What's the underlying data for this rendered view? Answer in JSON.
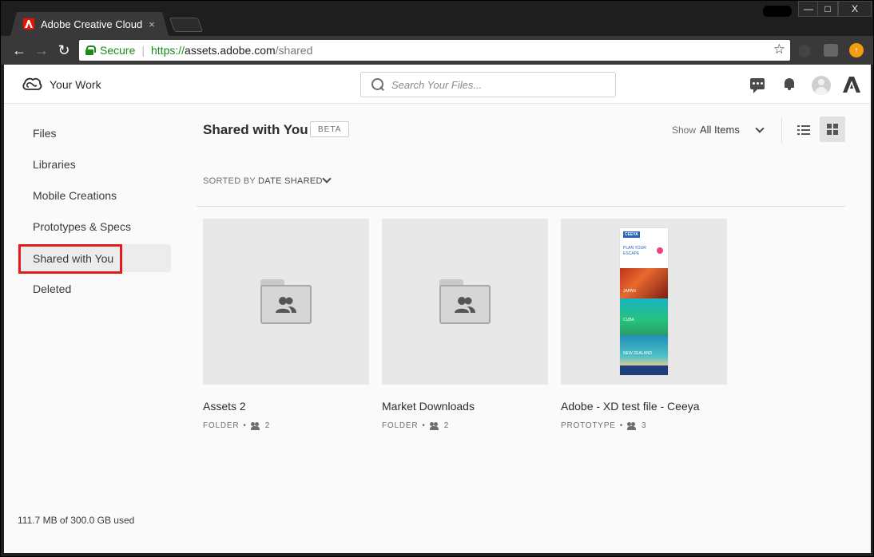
{
  "browser": {
    "tab_title": "Adobe Creative Cloud",
    "tab_close": "×",
    "win_min": "—",
    "win_max": "□",
    "win_close": "X",
    "nav_back": "←",
    "nav_forward": "→",
    "nav_reload": "↻",
    "secure_label": "Secure",
    "url_protocol": "https://",
    "url_host": "assets.adobe.com",
    "url_path": "/shared",
    "star": "☆",
    "ext_update": "↑"
  },
  "header": {
    "app_title": "Your Work",
    "search_placeholder": "Search Your Files..."
  },
  "sidebar": {
    "items": [
      {
        "label": "Files"
      },
      {
        "label": "Libraries"
      },
      {
        "label": "Mobile Creations"
      },
      {
        "label": "Prototypes & Specs"
      },
      {
        "label": "Shared with You",
        "active": true
      },
      {
        "label": "Deleted"
      }
    ],
    "storage": "111.7 MB of 300.0 GB used"
  },
  "main": {
    "title": "Shared with You",
    "badge": "BETA",
    "show_label": "Show",
    "show_value": "All Items",
    "sorted_by_label": "SORTED BY",
    "sorted_by_value": "DATE SHARED",
    "items": [
      {
        "name": "Assets 2",
        "type": "FOLDER",
        "dot": "•",
        "shared_count": "2"
      },
      {
        "name": "Market Downloads",
        "type": "FOLDER",
        "dot": "•",
        "shared_count": "2"
      },
      {
        "name": "Adobe - XD test file - Ceeya",
        "type": "PROTOTYPE",
        "dot": "•",
        "shared_count": "3"
      }
    ],
    "prototype_thumb": {
      "brand": "CEEYA",
      "headline_1": "PLAN YOUR",
      "headline_2": "ESCAPE",
      "label_1": "JAPAN",
      "label_2": "CUBA",
      "label_3": "NEW ZEALAND"
    }
  },
  "colors": {
    "accent_red": "#eb1000",
    "highlight_red": "#e41b1b",
    "secure_green": "#1a8a1a"
  }
}
